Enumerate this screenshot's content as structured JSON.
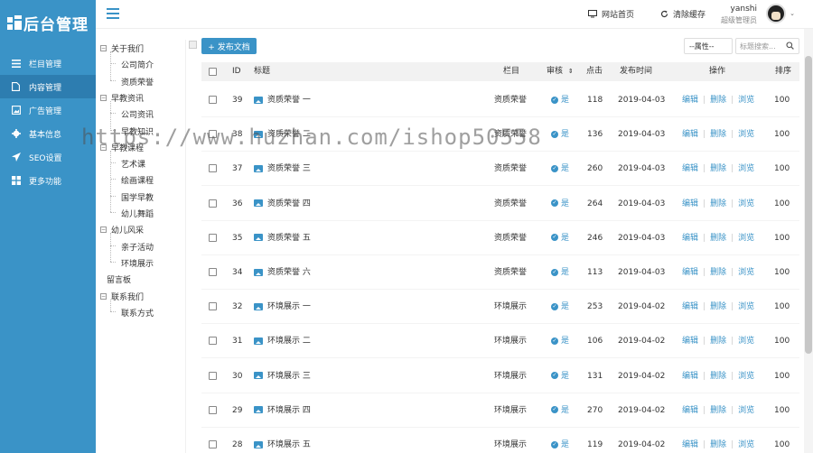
{
  "brand": {
    "title": "后台管理"
  },
  "nav": [
    {
      "label": "栏目管理",
      "icon": "list-icon",
      "active": false
    },
    {
      "label": "内容管理",
      "icon": "document-icon",
      "active": true
    },
    {
      "label": "广告管理",
      "icon": "image-icon",
      "active": false
    },
    {
      "label": "基本信息",
      "icon": "gear-icon",
      "active": false
    },
    {
      "label": "SEO设置",
      "icon": "send-icon",
      "active": false
    },
    {
      "label": "更多功能",
      "icon": "grid-icon",
      "active": false
    }
  ],
  "topbar": {
    "home_label": "网站首页",
    "clear_cache_label": "清除缓存",
    "user_name": "yanshi",
    "user_role": "超级管理员"
  },
  "tree": [
    {
      "label": "关于我们",
      "level": 0,
      "toggle": "−"
    },
    {
      "label": "公司简介",
      "level": 1
    },
    {
      "label": "资质荣誉",
      "level": 1
    },
    {
      "label": "早教资讯",
      "level": 0,
      "toggle": "−"
    },
    {
      "label": "公司资讯",
      "level": 1
    },
    {
      "label": "早教知识",
      "level": 1
    },
    {
      "label": "早教课程",
      "level": 0,
      "toggle": "−"
    },
    {
      "label": "艺术课",
      "level": 1
    },
    {
      "label": "绘画课程",
      "level": 1
    },
    {
      "label": "国学早教",
      "level": 1
    },
    {
      "label": "幼儿舞蹈",
      "level": 1
    },
    {
      "label": "幼儿风采",
      "level": 0,
      "toggle": "−"
    },
    {
      "label": "亲子活动",
      "level": 1
    },
    {
      "label": "环境展示",
      "level": 1
    },
    {
      "label": "留言板",
      "level": 0
    },
    {
      "label": "联系我们",
      "level": 0,
      "toggle": "−"
    },
    {
      "label": "联系方式",
      "level": 1
    }
  ],
  "toolbar": {
    "publish_label": "+ 发布文档",
    "attr_select_value": "--属性--",
    "search_placeholder": "标题搜索..."
  },
  "table": {
    "headers": {
      "id": "ID",
      "title": "标题",
      "column": "栏目",
      "audit": "审核",
      "clicks": "点击",
      "date": "发布时间",
      "ops": "操作",
      "sort": "排序"
    },
    "op_labels": {
      "edit": "编辑",
      "delete": "删除",
      "view": "浏览"
    },
    "rows": [
      {
        "id": "39",
        "title": "资质荣誉 一",
        "column": "资质荣誉",
        "audit": "是",
        "clicks": "118",
        "date": "2019-04-03",
        "sort": "100"
      },
      {
        "id": "38",
        "title": "资质荣誉 二",
        "column": "资质荣誉",
        "audit": "是",
        "clicks": "136",
        "date": "2019-04-03",
        "sort": "100"
      },
      {
        "id": "37",
        "title": "资质荣誉 三",
        "column": "资质荣誉",
        "audit": "是",
        "clicks": "260",
        "date": "2019-04-03",
        "sort": "100"
      },
      {
        "id": "36",
        "title": "资质荣誉 四",
        "column": "资质荣誉",
        "audit": "是",
        "clicks": "264",
        "date": "2019-04-03",
        "sort": "100"
      },
      {
        "id": "35",
        "title": "资质荣誉 五",
        "column": "资质荣誉",
        "audit": "是",
        "clicks": "246",
        "date": "2019-04-03",
        "sort": "100"
      },
      {
        "id": "34",
        "title": "资质荣誉 六",
        "column": "资质荣誉",
        "audit": "是",
        "clicks": "113",
        "date": "2019-04-03",
        "sort": "100"
      },
      {
        "id": "32",
        "title": "环境展示 一",
        "column": "环境展示",
        "audit": "是",
        "clicks": "253",
        "date": "2019-04-02",
        "sort": "100"
      },
      {
        "id": "31",
        "title": "环境展示 二",
        "column": "环境展示",
        "audit": "是",
        "clicks": "106",
        "date": "2019-04-02",
        "sort": "100"
      },
      {
        "id": "30",
        "title": "环境展示 三",
        "column": "环境展示",
        "audit": "是",
        "clicks": "131",
        "date": "2019-04-02",
        "sort": "100"
      },
      {
        "id": "29",
        "title": "环境展示 四",
        "column": "环境展示",
        "audit": "是",
        "clicks": "270",
        "date": "2019-04-02",
        "sort": "100"
      },
      {
        "id": "28",
        "title": "环境展示 五",
        "column": "环境展示",
        "audit": "是",
        "clicks": "119",
        "date": "2019-04-02",
        "sort": "100"
      }
    ]
  },
  "watermark": "https://www.huzhan.com/ishop50558",
  "colors": {
    "accent": "#3a93c7",
    "sidebar_active": "#2d7db0"
  }
}
